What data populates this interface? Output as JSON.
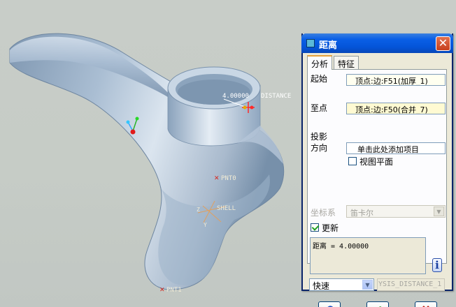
{
  "viewport": {
    "dimension": {
      "value": "4.00000",
      "label": "DISTANCE"
    },
    "points": [
      {
        "label": "PNT0"
      },
      {
        "label": "PNT1"
      }
    ],
    "csys": {
      "label": "SHELL",
      "axis_x": "Z",
      "axis_y": "Y"
    }
  },
  "dialog": {
    "title": "距离",
    "close_glyph": "✕",
    "tabs": [
      {
        "label": "分析"
      },
      {
        "label": "特征"
      }
    ],
    "from": {
      "label": "起始",
      "value": "顶点:边:F51(加厚_1)"
    },
    "to": {
      "label": "至点",
      "value": "顶点:边:F50(合并_7)"
    },
    "projection": {
      "label_line1": "投影",
      "label_line2": "方向",
      "value": "单击此处添加项目"
    },
    "view_plane": {
      "label": "视图平面",
      "checked": false
    },
    "csys": {
      "label": "坐标系",
      "value": "笛卡尔"
    },
    "update": {
      "label": "更新",
      "checked": true
    },
    "result": "距离 = 4.00000",
    "info_glyph": "i",
    "mode": {
      "value": "快速"
    },
    "name_field": "YSIS_DISTANCE_1",
    "buttons": {
      "repeat_glyph": "⟲",
      "ok_glyph": "✔",
      "cancel_glyph": "✖"
    }
  },
  "colors": {
    "title_bar": "#0454d8",
    "ok": "#1f9a1f",
    "cancel": "#c2170f",
    "repeat": "#1c4fc0"
  }
}
